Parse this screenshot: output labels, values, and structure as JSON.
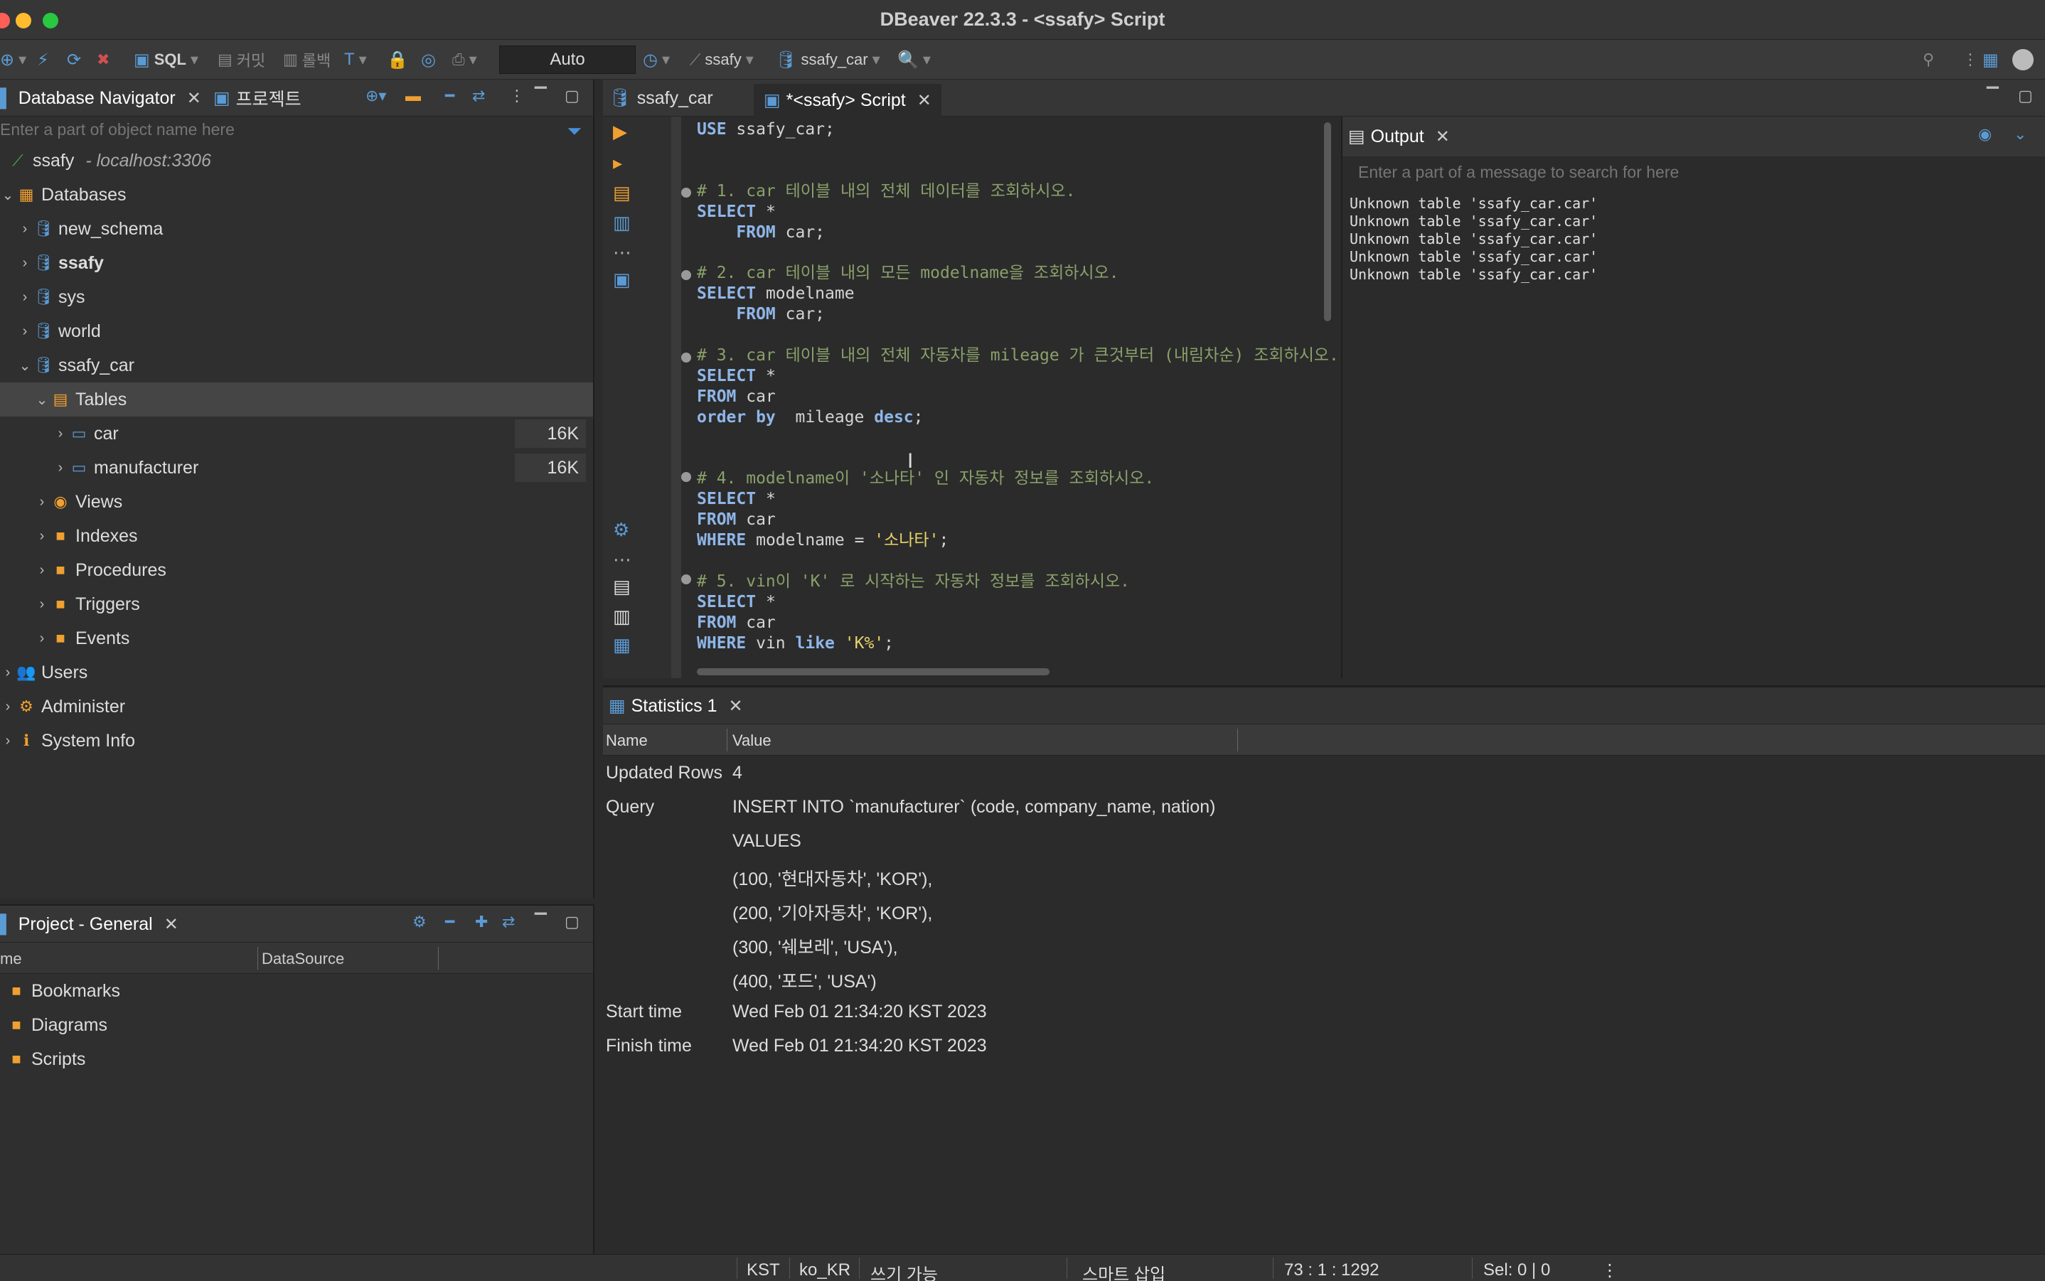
{
  "window": {
    "title": "DBeaver 22.3.3 - <ssafy> Script"
  },
  "toolbar": {
    "sql_label": "SQL",
    "commit_label": "커밋",
    "rollback_label": "롤백",
    "transaction_mode": "Auto",
    "datasource": "ssafy",
    "schema": "ssafy_car"
  },
  "navigator": {
    "tab_label": "Database Navigator",
    "projects_tab_label": "프로젝트",
    "filter_placeholder": "Enter a part of object name here",
    "connection": {
      "name": "ssafy",
      "host": "- localhost:3306"
    },
    "databases_label": "Databases",
    "schemas": [
      {
        "name": "new_schema"
      },
      {
        "name": "ssafy"
      },
      {
        "name": "sys"
      },
      {
        "name": "world"
      },
      {
        "name": "ssafy_car"
      }
    ],
    "tables_label": "Tables",
    "tables": [
      {
        "name": "car",
        "size": "16K"
      },
      {
        "name": "manufacturer",
        "size": "16K"
      }
    ],
    "folders": [
      "Views",
      "Indexes",
      "Procedures",
      "Triggers",
      "Events"
    ],
    "top_nodes": [
      "Users",
      "Administer",
      "System Info"
    ]
  },
  "project": {
    "tab_label": "Project - General",
    "col_name": "me",
    "col_datasource": "DataSource",
    "items": [
      "Bookmarks",
      "Diagrams",
      "Scripts"
    ]
  },
  "editor": {
    "tabs": [
      {
        "label": "ssafy_car"
      },
      {
        "label": "*<ssafy> Script"
      }
    ]
  },
  "output": {
    "tab_label": "Output",
    "search_placeholder": "Enter a part of a message to search for here",
    "lines": [
      "Unknown table 'ssafy_car.car'",
      "Unknown table 'ssafy_car.car'",
      "Unknown table 'ssafy_car.car'",
      "Unknown table 'ssafy_car.car'",
      "Unknown table 'ssafy_car.car'"
    ]
  },
  "statistics": {
    "tab_label": "Statistics 1",
    "col_name": "Name",
    "col_value": "Value",
    "rows": [
      {
        "key": "Updated Rows",
        "value": "4"
      },
      {
        "key": "Query",
        "value": "INSERT INTO `manufacturer` (code, company_name, nation)"
      },
      {
        "key": "",
        "value": "VALUES"
      },
      {
        "key": "",
        "value": "(100, '현대자동차', 'KOR'),"
      },
      {
        "key": "",
        "value": "(200, '기아자동차', 'KOR'),"
      },
      {
        "key": "",
        "value": "(300, '쉐보레', 'USA'),"
      },
      {
        "key": "",
        "value": "(400, '포드', 'USA')"
      },
      {
        "key": "Start time",
        "value": "Wed Feb 01 21:34:20 KST 2023"
      },
      {
        "key": "Finish time",
        "value": "Wed Feb 01 21:34:20 KST 2023"
      }
    ]
  },
  "statusbar": {
    "timezone": "KST",
    "locale": "ko_KR",
    "mode": "쓰기 가능",
    "insert_mode": "스마트 삽입",
    "position": "73 : 1 : 1292",
    "selection": "Sel: 0 | 0"
  },
  "colors": {
    "accent_blue": "#5b9bd5",
    "folder_orange": "#f0a030",
    "keyword": "#8fb6e8",
    "comment": "#8aa06a",
    "string": "#e8d36a"
  }
}
